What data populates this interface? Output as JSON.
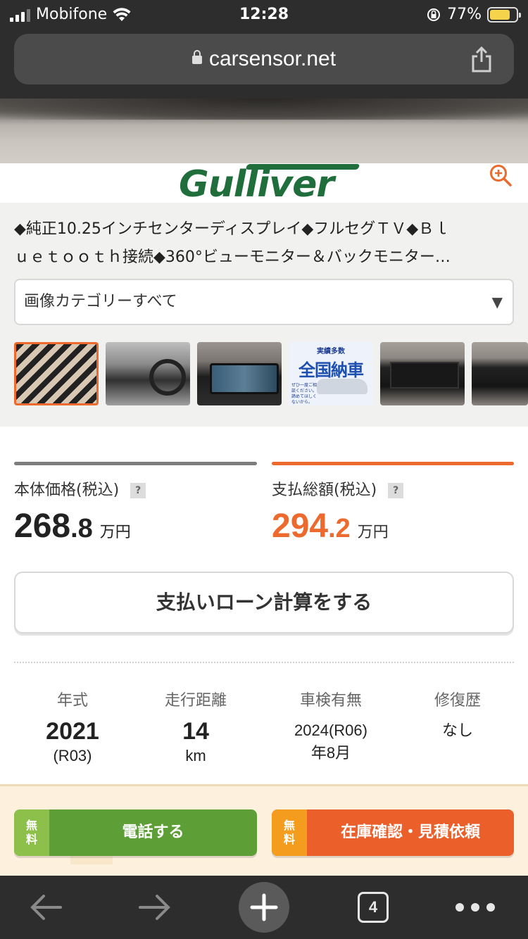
{
  "status": {
    "carrier": "Mobifone",
    "time": "12:28",
    "battery": "77%"
  },
  "browser": {
    "url": "carsensor.net"
  },
  "logo": "Gulliver",
  "description": {
    "line1": "◆純正10.25インチセンターディスプレイ◆フルセグＴＶ◆Ｂｌ",
    "line2": "ｕｅｔｏｏｔｈ接続◆360°ビューモニター＆バックモニター…"
  },
  "category_select": {
    "value": "画像カテゴリーすべて",
    "arrow": "▼"
  },
  "thumbnails": [
    {
      "name": "thumb-1",
      "selected": true
    },
    {
      "name": "thumb-2"
    },
    {
      "name": "thumb-3"
    },
    {
      "name": "thumb-4",
      "label_top": "実績多数",
      "label_main": "全国納車",
      "label_small": "ぜひ一度ご相談ください。 諦めてほしくないから。"
    },
    {
      "name": "thumb-5"
    },
    {
      "name": "thumb-6"
    }
  ],
  "prices": {
    "base": {
      "label": "本体価格(税込)",
      "int": "268",
      "dec": ".8",
      "unit": "万円"
    },
    "total": {
      "label": "支払総額(税込)",
      "int": "294",
      "dec": ".2",
      "unit": "万円"
    },
    "help": "?"
  },
  "loan_button": "支払いローン計算をする",
  "specs": {
    "year": {
      "label": "年式",
      "value": "2021",
      "sub": "(R03)"
    },
    "mileage": {
      "label": "走行距離",
      "value": "14",
      "sub": "km"
    },
    "inspection": {
      "label": "車検有無",
      "line1": "2024(R06)",
      "line2": "年8月"
    },
    "repair": {
      "label": "修復歴",
      "value": "なし"
    }
  },
  "cta": {
    "call": {
      "tag1": "無",
      "tag2": "料",
      "label": "電話する"
    },
    "quote": {
      "tag1": "無",
      "tag2": "料",
      "label": "在庫確認・見積依頼"
    }
  },
  "toolbar": {
    "tab_count": "4"
  },
  "colors": {
    "accent": "#ec6a2d",
    "green": "#5e9e36",
    "brand_green": "#1f6e3c"
  }
}
